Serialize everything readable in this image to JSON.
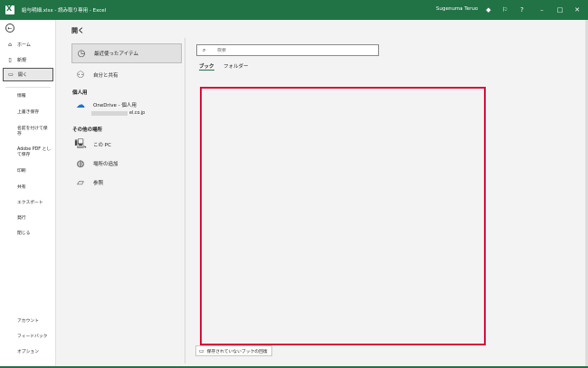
{
  "window": {
    "title": "給与明細.xlsx  -  読み取り専用  -  Excel",
    "user": "Sugenuma Teruo",
    "controls": [
      "diamond-icon",
      "feedback-icon",
      "help-icon",
      "minimize-icon",
      "maximize-icon",
      "close-icon"
    ]
  },
  "nav": {
    "back_icon": "←",
    "home": "ホーム",
    "new": "新規",
    "open": "開く",
    "info": "情報",
    "save": "上書き保存",
    "save_as": "名前を付けて保",
    "save_as_2": "存",
    "save_pdf": "Adobe PDF とし",
    "save_pdf_2": "て保存",
    "print": "印刷",
    "share": "共有",
    "export": "エクスポート",
    "publish": "発行",
    "close": "閉じる",
    "account": "アカウント",
    "feedback": "フィードバック",
    "options": "オプション"
  },
  "main": {
    "title": "開く",
    "recent": "最近使ったアイテム",
    "shared": "自分と共有",
    "personal_header": "個人用",
    "onedrive": "OneDrive - 個人用",
    "onedrive_account": "el.co.jp",
    "other_header": "その他の場所",
    "this_pc": "この PC",
    "add_place": "場所の追加",
    "browse": "参照",
    "search_placeholder": "検索",
    "tab_books": "ブック",
    "tab_folders": "フォルダー",
    "recover_button": "保存されていないブックの回復"
  },
  "colors": {
    "brand": "#217346",
    "highlight_box": "#d80f3b"
  }
}
